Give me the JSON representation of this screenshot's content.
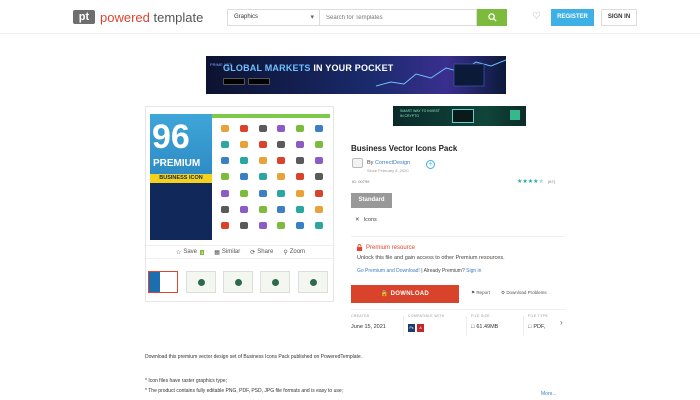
{
  "header": {
    "logo_mark": "pt",
    "logo_word1": "powered",
    "logo_word2": "template",
    "category_value": "Graphics",
    "search_placeholder": "Search for Templates",
    "register_label": "REGISTER",
    "signin_label": "SIGN IN",
    "accent_color": "#e0442f",
    "search_color": "#7dbb3c"
  },
  "banners": {
    "top_tag": "PRIME XBT",
    "top_text_1": "GLOBAL MARKETS",
    "top_text_2": " IN YOUR POCKET",
    "side_text": "SMART WAY TO INVEST IN CRYPTO"
  },
  "product": {
    "image": {
      "number": "96",
      "premium": "PREMIUM",
      "business_icon": "BUSINESS ICON"
    },
    "actions": {
      "save": "Save",
      "save_count": "3",
      "similar": "Similar",
      "share": "Share",
      "zoom": "Zoom"
    },
    "title": "Business Vector Icons Pack",
    "author_prefix": "By ",
    "author_name": "CorrectDesign",
    "since": "Since February 8, 2020",
    "id_line": "ID: 00799",
    "rating_count": "(67)",
    "rating_value": 4.5,
    "standard_label": "Standard",
    "license_label": "Icons",
    "premium_title": "Premium resource",
    "premium_desc": "Unlock this file and gain access to other Premium resources.",
    "premium_link1": "Go Premium and Download!",
    "premium_mid": " | Already Premium? ",
    "premium_link2": "Sign in",
    "download_label": "DOWNLOAD",
    "report_label": "Report",
    "download_problems_label": "Download Problems",
    "meta": {
      "created_label": "CREATED",
      "created_value": "June 15, 2021",
      "compat_label": "COMPATIBLE WITH",
      "size_label": "FILE SIZE",
      "size_value": "61.49MB",
      "type_label": "FILE TYPE",
      "type_value": "PDF, "
    }
  },
  "description": {
    "intro": "Download this premium vector design set of Business Icons Pack published on PoweredTemplate.",
    "bullet1": "* Icon files have raster graphics type;",
    "bullet2": "* The product contains fully editable PNG, PDF, PSD, JPG file formats and is easy to use;",
    "more": "More..."
  }
}
